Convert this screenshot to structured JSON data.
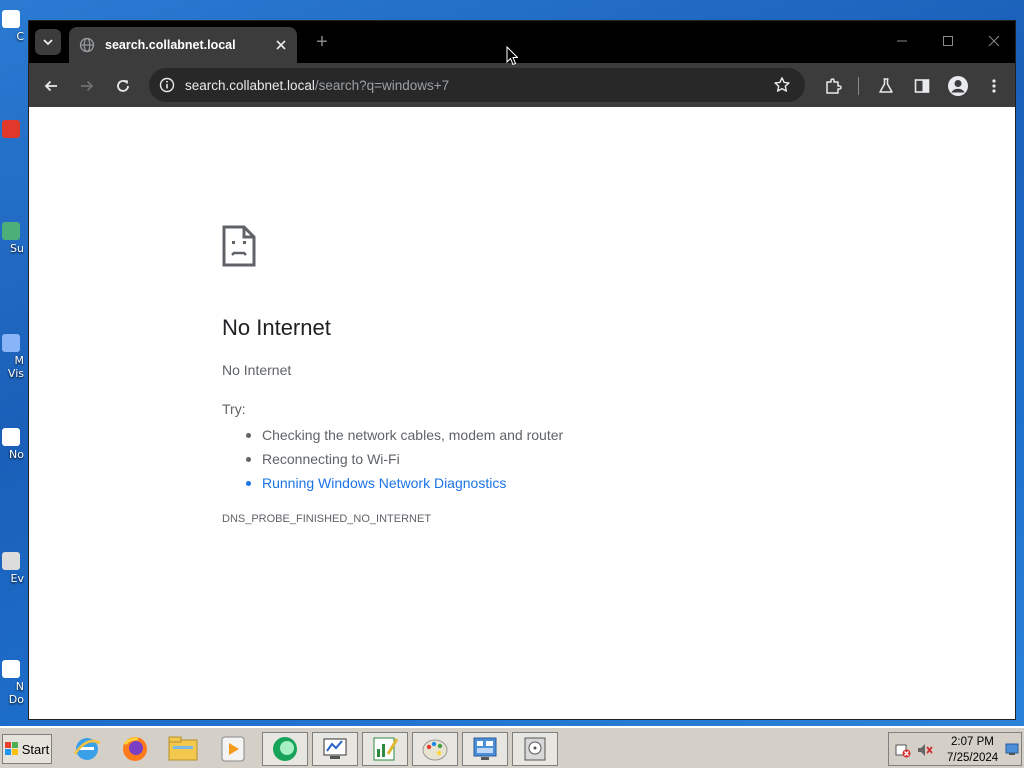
{
  "desktop": {
    "icons": [
      {
        "label": "C"
      },
      {
        "label": "Su"
      },
      {
        "label": "M Vis"
      },
      {
        "label": "No"
      },
      {
        "label": "Ev"
      },
      {
        "label": "N Do"
      }
    ]
  },
  "browser": {
    "tab": {
      "title": "search.collabnet.local",
      "new_tab_symbol": "+"
    },
    "address_bar": {
      "host": "search.collabnet.local",
      "path": "/search?q=windows+7"
    }
  },
  "error_page": {
    "title": "No Internet",
    "description": "No Internet",
    "try_label": "Try:",
    "suggestions": [
      "Checking the network cables, modem and router",
      "Reconnecting to Wi-Fi",
      "Running Windows Network Diagnostics"
    ],
    "error_code": "DNS_PROBE_FINISHED_NO_INTERNET"
  },
  "taskbar": {
    "start_label": "Start",
    "apps": [
      "ie-icon",
      "firefox-icon",
      "file-explorer-icon",
      "media-player-icon",
      "chat-icon",
      "system-monitor-icon",
      "spreadsheet-icon",
      "paint-icon",
      "control-panel-icon",
      "disk-utility-icon"
    ],
    "clock_time": "2:07 PM",
    "clock_date": "7/25/2024"
  },
  "colors": {
    "link": "#1a73e8",
    "browser_chrome": "#3c3c3c",
    "titlebar": "#000000"
  }
}
